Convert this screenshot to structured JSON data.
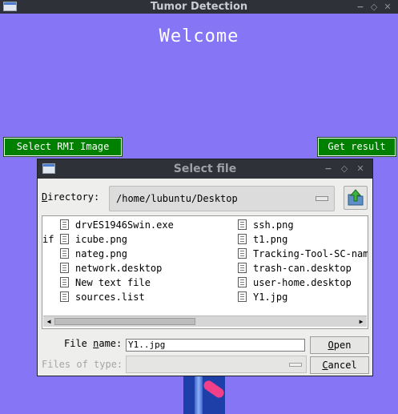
{
  "main_window": {
    "title": "Tumor Detection",
    "controls": {
      "minimize": "−",
      "maximize": "◇",
      "close": "✕"
    },
    "welcome": "Welcome",
    "select_button": "Select RMI Image",
    "result_button": "Get result"
  },
  "dialog": {
    "title": "Select file",
    "controls": {
      "minimize": "−",
      "maximize": "◇",
      "close": "✕"
    },
    "directory_label_prefix": "D",
    "directory_label_rest": "irectory:",
    "directory_path": "/home/lubuntu/Desktop",
    "clipped_text": "if",
    "files_left": [
      "drvES1946Swin.exe",
      "icube.png",
      "nateg.png",
      "network.desktop",
      "New text file",
      "sources.list"
    ],
    "files_right": [
      "ssh.png",
      "t1.png",
      "Tracking-Tool-SC-name",
      "trash-can.desktop",
      "user-home.desktop",
      "Y1.jpg"
    ],
    "file_name_label_a": "File ",
    "file_name_label_u": "n",
    "file_name_label_b": "ame:",
    "file_name_value": "Y1..jpg",
    "files_of_type_label": "Files of type:",
    "open_label_u": "O",
    "open_label_rest": "pen",
    "cancel_label_u": "C",
    "cancel_label_rest": "ancel"
  },
  "colors": {
    "background": "#8675f5",
    "accent_green": "#008000",
    "titlebar": "#2e3238"
  },
  "icons": [
    "app-window-icon",
    "folder-up-icon",
    "document-icon"
  ]
}
